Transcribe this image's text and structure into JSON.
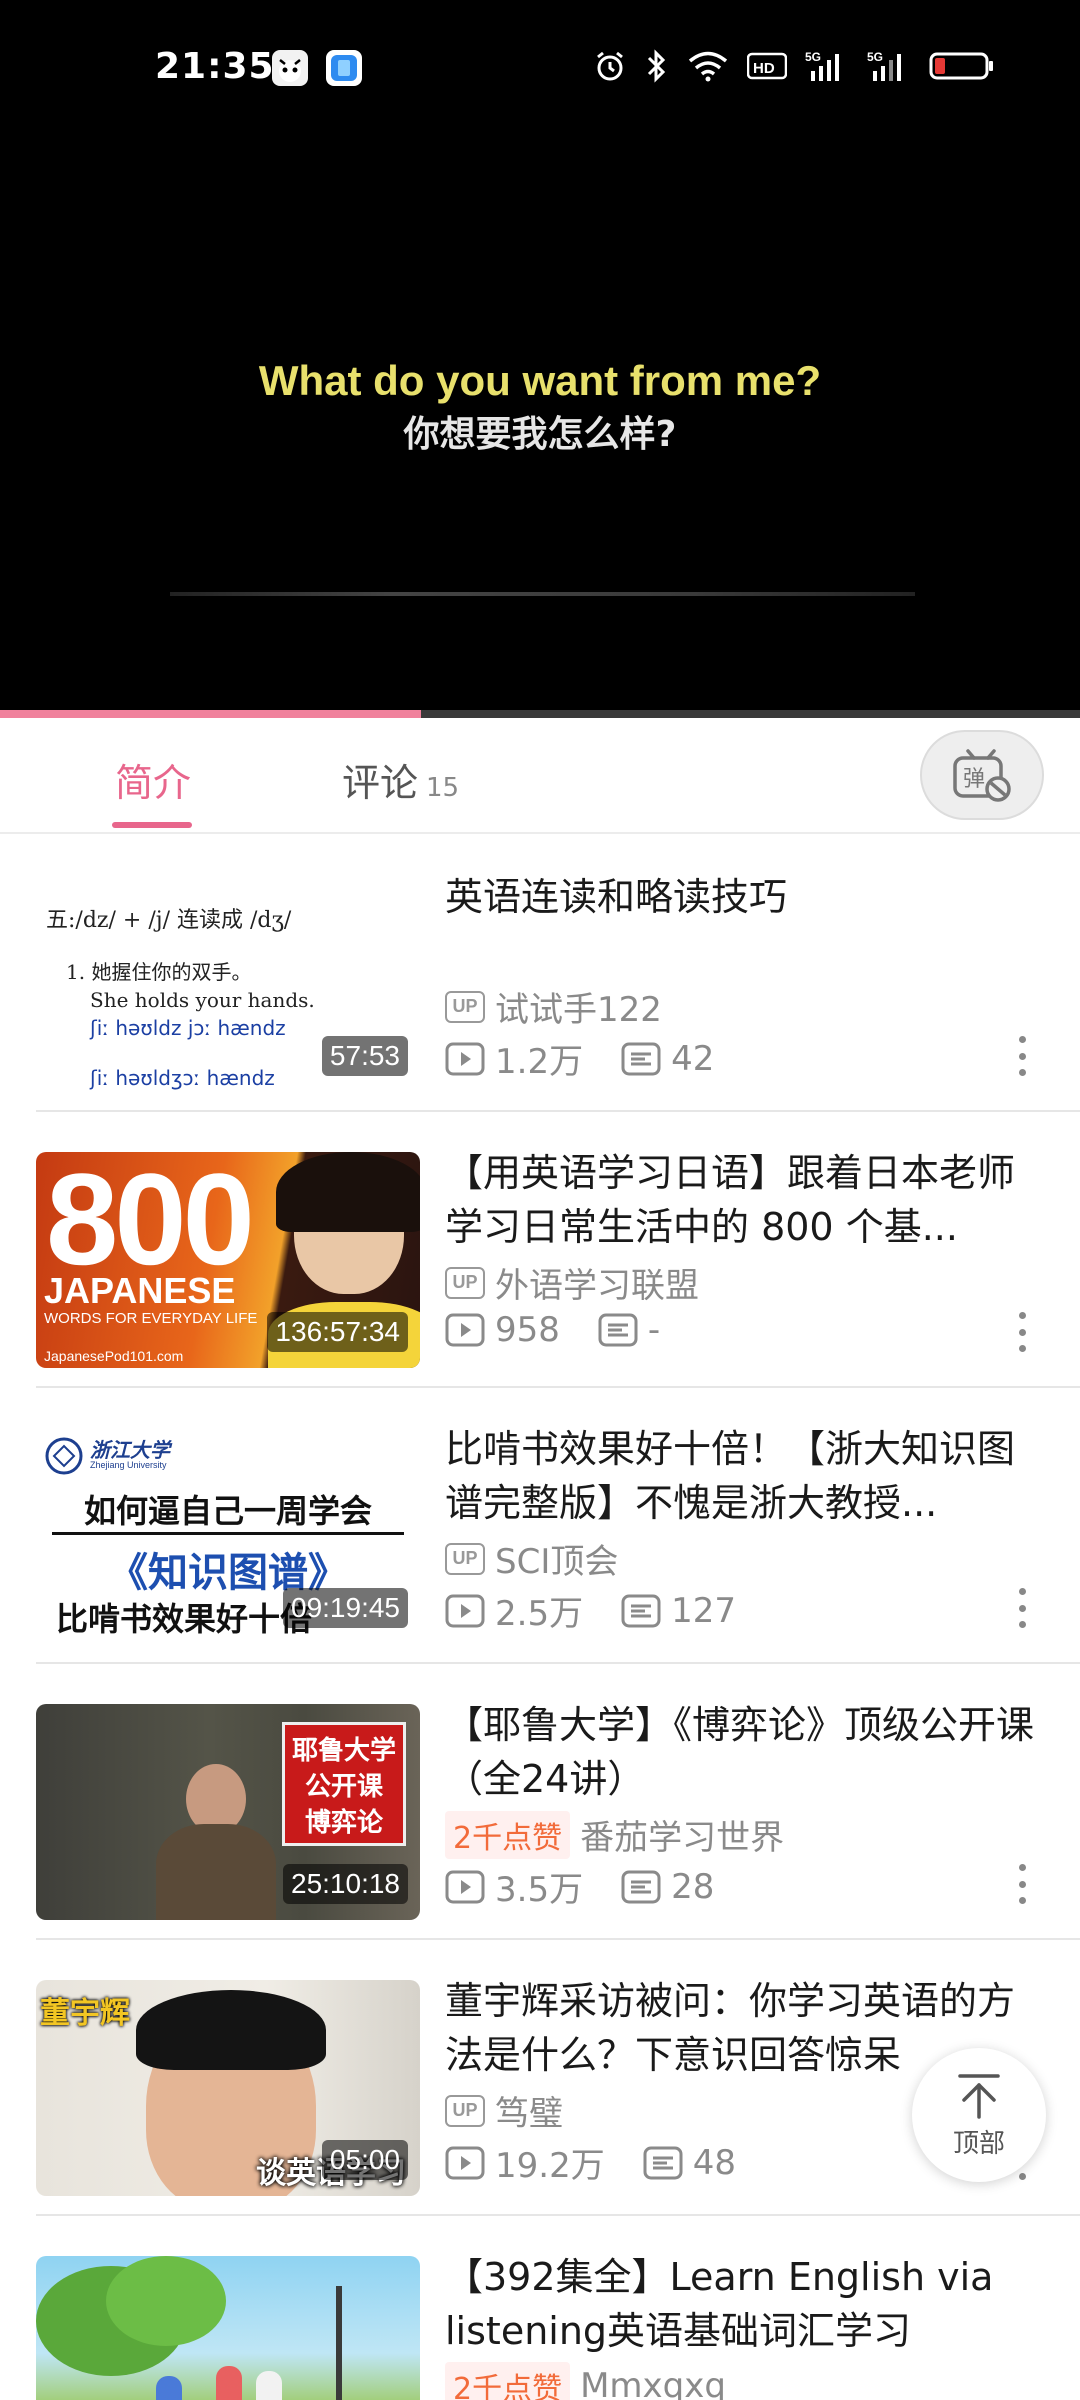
{
  "status_bar": {
    "time": "21:35",
    "icons": [
      "alarm-icon",
      "bluetooth-icon",
      "wifi-icon",
      "hd-icon",
      "signal-5g-icon",
      "signal-5g-icon",
      "battery-low-icon"
    ]
  },
  "video": {
    "subtitle_en": "What do you want from me?",
    "subtitle_zh": "你想要我怎么样?",
    "progress_fraction": 0.39
  },
  "tabs": {
    "intro": "简介",
    "comments": "评论",
    "comments_count": "15",
    "danmaku_icon": "danmaku-off-icon"
  },
  "colors": {
    "accent": "#e8668c",
    "likes": "#f26b3a",
    "meta": "#8a8a8a"
  },
  "videos": [
    {
      "title": "英语连读和略读技巧",
      "author": "试试手122",
      "author_badge": "UP",
      "views": "1.2万",
      "comments": "42",
      "duration": "57:53"
    },
    {
      "title": "【用英语学习日语】跟着日本老师学习日常生活中的 800 个基...",
      "author": "外语学习联盟",
      "author_badge": "UP",
      "views": "958",
      "comments": "-",
      "duration": "136:57:34"
    },
    {
      "title": "比啃书效果好十倍！【浙大知识图谱完整版】不愧是浙大教授...",
      "author": "SCI顶会",
      "author_badge": "UP",
      "views": "2.5万",
      "comments": "127",
      "duration": "09:19:45"
    },
    {
      "title": "【耶鲁大学】《博弈论》顶级公开课（全24讲）",
      "author": "番茄学习世界",
      "author_badge": "2千点赞",
      "views": "3.5万",
      "comments": "28",
      "duration": "25:10:18"
    },
    {
      "title": "董宇辉采访被问：你学习英语的方法是什么？下意识回答惊呆",
      "author": "笃璧",
      "author_badge": "UP",
      "views": "19.2万",
      "comments": "48",
      "duration": "05:00"
    },
    {
      "title": "【392集全】Learn English via listening英语基础词汇学习",
      "author": "Mmxqxq",
      "author_badge": "2千点赞",
      "views": "",
      "comments": "",
      "duration": ""
    }
  ],
  "thumbs": {
    "t1": {
      "line1": "五:/dz/ + /j/ 连读成 /dʒ/",
      "line2": "1. 她握住你的双手。",
      "line3": "She holds your hands.",
      "line4": "ʃiː həʊldz jɔː hændz",
      "line5": "ʃiː həʊldʒɔː hændz"
    },
    "t2": {
      "big": "800",
      "word": "JAPANESE",
      "sub": "WORDS FOR EVERYDAY LIFE",
      "site": "JapanesePod101.com"
    },
    "t3": {
      "univ": "浙江大学",
      "univ_en": "Zhejiang University",
      "l1": "如何逼自己一周学会",
      "l2": "《知识图谱》",
      "l3": "比啃书效果好十倍"
    },
    "t4": {
      "sign1": "耶鲁大学",
      "sign2": "公开课",
      "sign3": "博弈论"
    },
    "t5": {
      "name": "董宇辉",
      "caption": "谈英语学习"
    }
  },
  "back_to_top": {
    "label": "顶部"
  }
}
